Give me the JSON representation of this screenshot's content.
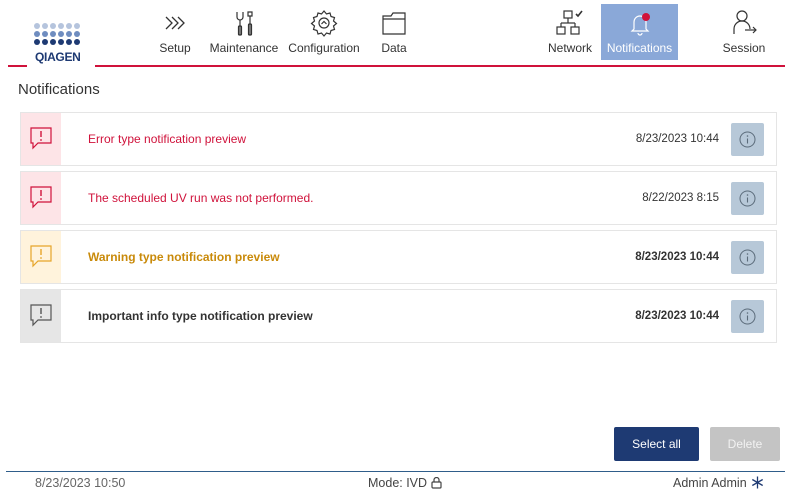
{
  "brand": {
    "name": "QIAGEN",
    "color_primary": "#1e3a73",
    "color_accent": "#d0123b"
  },
  "nav": {
    "setup": {
      "label": "Setup",
      "icon": "chevrons-right-icon"
    },
    "maintenance": {
      "label": "Maintenance",
      "icon": "tools-icon"
    },
    "configuration": {
      "label": "Configuration",
      "icon": "gear-icon"
    },
    "data": {
      "label": "Data",
      "icon": "folder-icon"
    },
    "network": {
      "label": "Network",
      "icon": "network-icon"
    },
    "notifications": {
      "label": "Notifications",
      "icon": "bell-icon",
      "active": true
    },
    "session": {
      "label": "Session",
      "icon": "user-logout-icon"
    }
  },
  "page": {
    "title": "Notifications"
  },
  "notifications": [
    {
      "type": "error",
      "text": "Error type notification preview",
      "time": "8/23/2023 10:44",
      "bold": false,
      "text_color": "#d0123b",
      "icon_bg": "#fde4e7",
      "icon_color": "#d0123b"
    },
    {
      "type": "error",
      "text": "The scheduled UV run was not performed.",
      "time": "8/22/2023 8:15",
      "bold": false,
      "text_color": "#d0123b",
      "icon_bg": "#fde4e7",
      "icon_color": "#d0123b"
    },
    {
      "type": "warning",
      "text": "Warning type notification preview",
      "time": "8/23/2023 10:44",
      "bold": true,
      "text_color": "#c98a0a",
      "icon_bg": "#fff3dc",
      "icon_color": "#e6a52a"
    },
    {
      "type": "info",
      "text": "Important info type notification preview",
      "time": "8/23/2023 10:44",
      "bold": true,
      "text_color": "#333333",
      "icon_bg": "#e6e6e6",
      "icon_color": "#555555"
    }
  ],
  "buttons": {
    "select_all": "Select all",
    "delete": "Delete"
  },
  "status_bar": {
    "time": "8/23/2023 10:50",
    "mode": "Mode: IVD",
    "user": "Admin Admin"
  }
}
